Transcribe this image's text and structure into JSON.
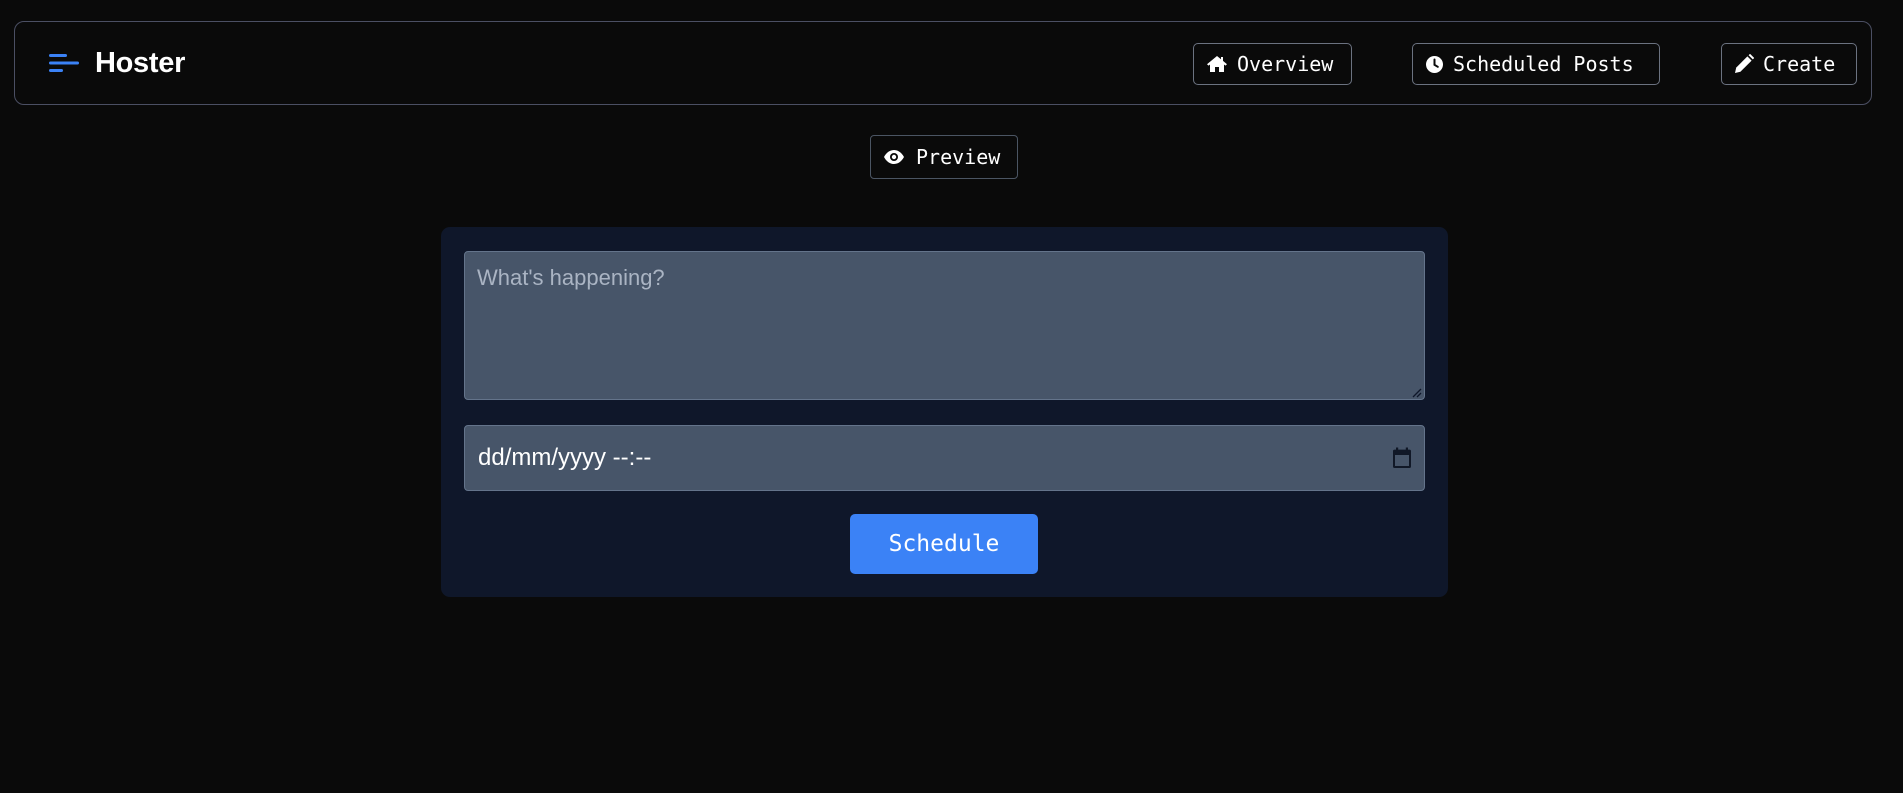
{
  "header": {
    "brand_title": "Hoster",
    "brand_icon": "menu-lines-icon",
    "accent_color": "#3b82f6",
    "nav": {
      "overview_label": "Overview",
      "overview_icon": "home-icon",
      "scheduled_label": "Scheduled Posts",
      "scheduled_icon": "clock-icon",
      "create_label": "Create",
      "create_icon": "pencil-icon"
    }
  },
  "preview": {
    "label": "Preview",
    "icon": "eye-icon"
  },
  "composer": {
    "post_value": "",
    "post_placeholder": "What's happening?",
    "datetime_display": "dd/mm/yyyy --:--",
    "calendar_icon": "calendar-icon",
    "schedule_label": "Schedule",
    "schedule_color": "#3b82f6"
  }
}
